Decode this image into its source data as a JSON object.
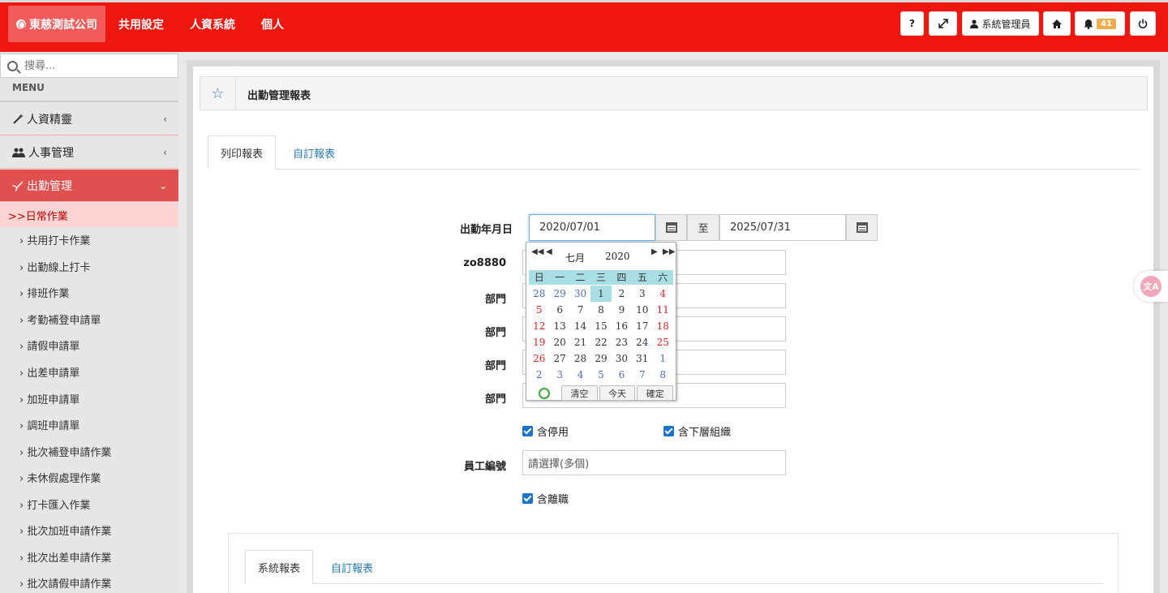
{
  "topbar": {
    "company": "東慈測試公司",
    "nav": [
      "共用設定",
      "人資系統",
      "個人"
    ],
    "help_label": "?",
    "user_label": "系統管理員",
    "notification_count": "41",
    "accent_color": "#ef1610"
  },
  "sidebar": {
    "search_placeholder": "搜尋...",
    "menu_title": "MENU",
    "items": [
      {
        "label": "人資精靈",
        "icon": "magic-wand-icon"
      },
      {
        "label": "人事管理",
        "icon": "users-icon"
      },
      {
        "label": "出勤管理",
        "icon": "plane-icon"
      }
    ],
    "submenu_head": ">>日常作業",
    "subitems": [
      "共用打卡作業",
      "出勤線上打卡",
      "排班作業",
      "考勤補登申請單",
      "請假申請單",
      "出差申請單",
      "加班申請單",
      "調班申請單",
      "批次補登申請作業",
      "未休假處理作業",
      "打卡匯入作業",
      "批次加班申請作業",
      "批次出差申請作業",
      "批次請假申請作業"
    ]
  },
  "panel": {
    "title": "出勤管理報表",
    "tabs": [
      "列印報表",
      "自訂報表"
    ]
  },
  "form": {
    "date_label": "出勤年月日",
    "date_from": "2020/07/01",
    "to_label": "至",
    "date_to": "2025/07/31",
    "company_label": "zo8880",
    "dept_labels": [
      "部門",
      "部門",
      "部門",
      "部門"
    ],
    "chk_disabled": "含停用",
    "chk_sub_org": "含下層組織",
    "emp_label": "員工編號",
    "emp_placeholder": "請選擇(多個)",
    "chk_resigned": "含離職"
  },
  "datepicker": {
    "month": "七月",
    "year": "2020",
    "weekdays": [
      "日",
      "一",
      "二",
      "三",
      "四",
      "五",
      "六"
    ],
    "weeks": [
      [
        "28",
        "29",
        "30",
        "1",
        "2",
        "3",
        "4"
      ],
      [
        "5",
        "6",
        "7",
        "8",
        "9",
        "10",
        "11"
      ],
      [
        "12",
        "13",
        "14",
        "15",
        "16",
        "17",
        "18"
      ],
      [
        "19",
        "20",
        "21",
        "22",
        "23",
        "24",
        "25"
      ],
      [
        "26",
        "27",
        "28",
        "29",
        "30",
        "31",
        "1"
      ],
      [
        "2",
        "3",
        "4",
        "5",
        "6",
        "7",
        "8"
      ]
    ],
    "footer": [
      "清空",
      "今天",
      "確定"
    ]
  },
  "lower": {
    "tabs": [
      "系統報表",
      "自訂報表"
    ]
  }
}
